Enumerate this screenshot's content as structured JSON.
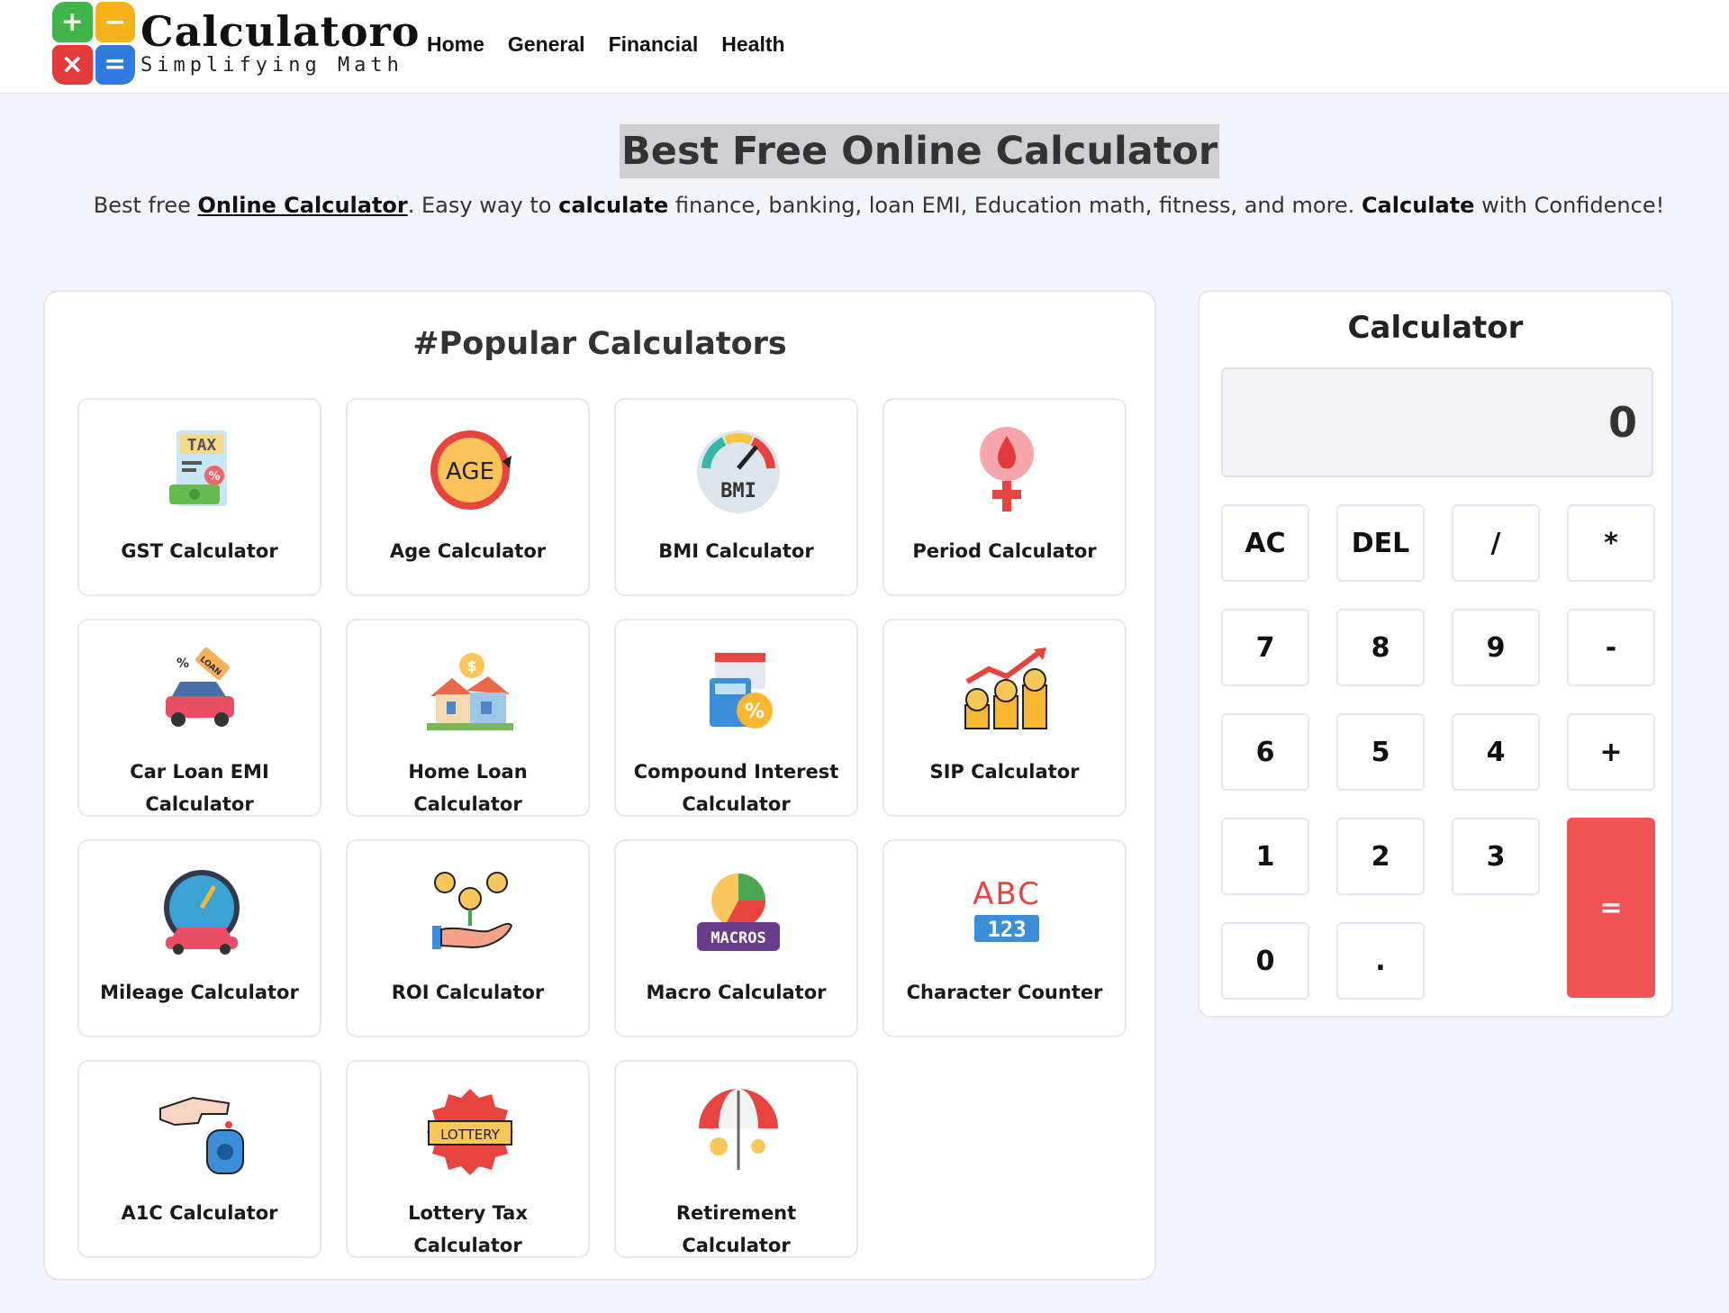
{
  "header": {
    "logo": {
      "title": "Calculatoro",
      "tagline": "Simplifying Math",
      "symbols": [
        "+",
        "−",
        "×",
        "="
      ]
    },
    "nav": [
      "Home",
      "General",
      "Financial",
      "Health"
    ]
  },
  "hero": {
    "title": "Best Free Online Calculator",
    "subtitle": {
      "part1": "Best free ",
      "link": "Online Calculator",
      "part2": ". Easy way to ",
      "bold1": "calculate",
      "part3": " finance, banking, loan EMI, Education math, fitness, and more. ",
      "bold2": "Calculate",
      "part4": " with Confidence!"
    }
  },
  "popular": {
    "title": "#Popular Calculators",
    "cards": [
      {
        "label": "GST Calculator",
        "icon": "tax-receipt-icon"
      },
      {
        "label": "Age Calculator",
        "icon": "age-icon"
      },
      {
        "label": "BMI Calculator",
        "icon": "bmi-gauge-icon"
      },
      {
        "label": "Period Calculator",
        "icon": "female-drop-icon"
      },
      {
        "label": "Car Loan EMI Calculator",
        "icon": "car-loan-icon"
      },
      {
        "label": "Home Loan Calculator",
        "icon": "house-coin-icon"
      },
      {
        "label": "Compound Interest Calculator",
        "icon": "calendar-calculator-icon"
      },
      {
        "label": "SIP Calculator",
        "icon": "coins-growth-icon"
      },
      {
        "label": "Mileage Calculator",
        "icon": "speedometer-car-icon"
      },
      {
        "label": "ROI Calculator",
        "icon": "hand-coins-icon"
      },
      {
        "label": "Macro Calculator",
        "icon": "macros-pie-icon"
      },
      {
        "label": "Character Counter",
        "icon": "abc-123-icon"
      },
      {
        "label": "A1C Calculator",
        "icon": "glucose-meter-icon"
      },
      {
        "label": "Lottery Tax Calculator",
        "icon": "lottery-badge-icon"
      },
      {
        "label": "Retirement Calculator",
        "icon": "umbrella-coins-icon"
      }
    ],
    "icon_text": {
      "tax": "TAX",
      "age": "AGE",
      "bmi": "BMI",
      "loan": "LOAN",
      "macros": "MACROS",
      "abc": "ABC",
      "num": "123",
      "lottery": "LOTTERY"
    }
  },
  "calculator": {
    "title": "Calculator",
    "display": "0",
    "keys": {
      "ac": "AC",
      "del": "DEL",
      "div": "/",
      "mul": "*",
      "k7": "7",
      "k8": "8",
      "k9": "9",
      "minus": "-",
      "k6": "6",
      "k5": "5",
      "k4": "4",
      "plus": "+",
      "k1": "1",
      "k2": "2",
      "k3": "3",
      "eq": "=",
      "k0": "0",
      "dot": "."
    },
    "accent_color": "#f15454"
  }
}
